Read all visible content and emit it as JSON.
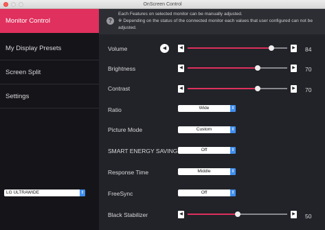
{
  "window": {
    "title": "OnScreen Control"
  },
  "sidebar": {
    "items": [
      {
        "label": "Monitor Control"
      },
      {
        "label": "My Display Presets"
      },
      {
        "label": "Screen Split"
      },
      {
        "label": "Settings"
      }
    ],
    "monitor_select": {
      "value": "LG ULTRAWIDE",
      "arrow_icon": "up-down-chevron-icon"
    }
  },
  "info": {
    "icon": "question-icon",
    "line1": "Each Features on selected monitor can be manually adjusted.",
    "line2": "※ Depending on the status of the connected monitor each values that user configured can not be adjusted."
  },
  "controls": {
    "volume": {
      "label": "Volume",
      "value": "84",
      "level": 84
    },
    "brightness": {
      "label": "Brightness",
      "value": "70",
      "level": 70
    },
    "contrast": {
      "label": "Contrast",
      "value": "70",
      "level": 70
    },
    "ratio": {
      "label": "Ratio",
      "selected": "Wide"
    },
    "picture_mode": {
      "label": "Picture Mode",
      "selected": "Custom"
    },
    "smart_energy_saving": {
      "label": "SMART ENERGY SAVING",
      "selected": "Off"
    },
    "response_time": {
      "label": "Response Time",
      "selected": "Middle"
    },
    "freesync": {
      "label": "FreeSync",
      "selected": "Off"
    },
    "black_stabilizer": {
      "label": "Black Stabilizer",
      "value": "50",
      "level": 50
    }
  },
  "colors": {
    "accent": "#e0305d",
    "sidebar_bg": "#151519",
    "main_bg": "#222328",
    "select_arrow": "#3f8ff0"
  }
}
